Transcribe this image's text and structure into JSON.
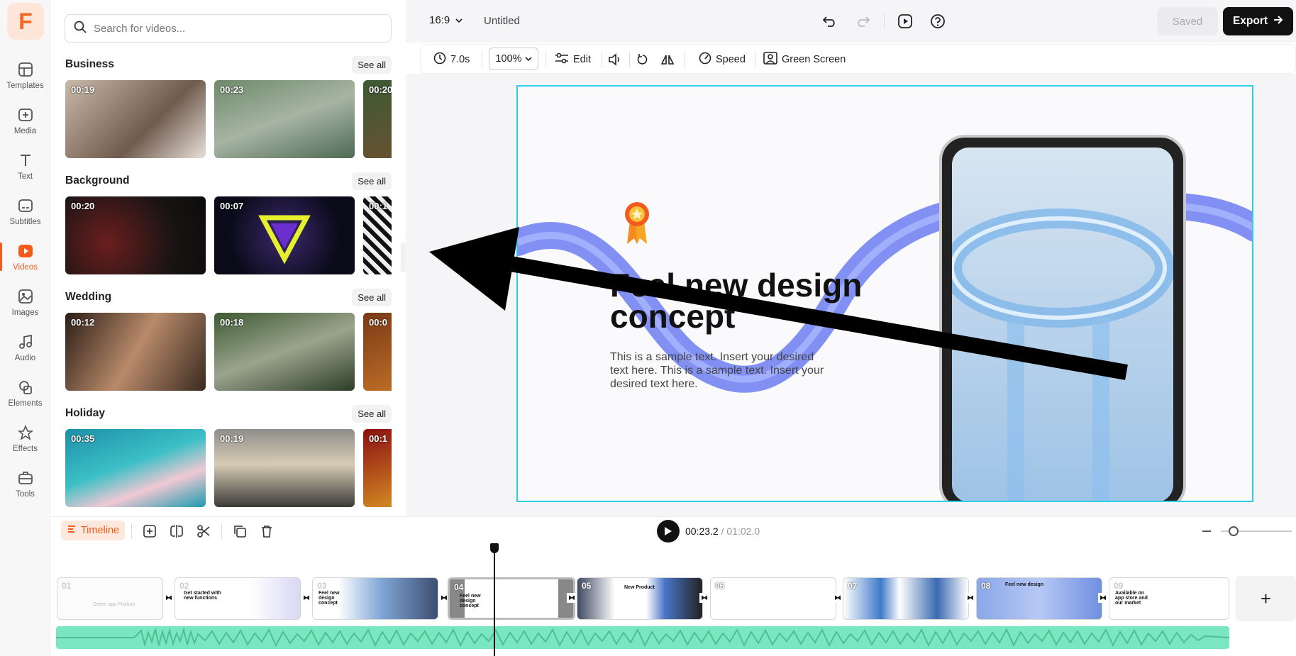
{
  "app": {
    "logo_letter": "F",
    "accent": "#f25b1c",
    "selection_color": "#2ad1e6"
  },
  "rail": [
    {
      "label": "Templates",
      "icon": "templates-icon"
    },
    {
      "label": "Media",
      "icon": "media-icon"
    },
    {
      "label": "Text",
      "icon": "text-icon"
    },
    {
      "label": "Subtitles",
      "icon": "subtitles-icon"
    },
    {
      "label": "Videos",
      "icon": "videos-icon",
      "active": true
    },
    {
      "label": "Images",
      "icon": "images-icon"
    },
    {
      "label": "Audio",
      "icon": "audio-icon"
    },
    {
      "label": "Elements",
      "icon": "elements-icon"
    },
    {
      "label": "Effects",
      "icon": "effects-icon"
    },
    {
      "label": "Tools",
      "icon": "tools-icon"
    }
  ],
  "panel": {
    "search_placeholder": "Search for videos...",
    "see_all": "See all",
    "categories": [
      {
        "title": "Business",
        "thumbs": [
          "00:19",
          "00:23",
          "00:20"
        ]
      },
      {
        "title": "Background",
        "thumbs": [
          "00:20",
          "00:07",
          "00:1"
        ]
      },
      {
        "title": "Wedding",
        "thumbs": [
          "00:12",
          "00:18",
          "00:0"
        ]
      },
      {
        "title": "Holiday",
        "thumbs": [
          "00:35",
          "00:19",
          "00:1"
        ]
      }
    ]
  },
  "topbar": {
    "ratio": "16:9",
    "title": "Untitled",
    "saved": "Saved",
    "export": "Export"
  },
  "toolbar": {
    "duration": "7.0s",
    "zoom": "100%",
    "edit": "Edit",
    "speed": "Speed",
    "green_screen": "Green Screen"
  },
  "canvas": {
    "headline": "Feel new design concept",
    "body": "This is a sample text. Insert your desired text here. This is a sample text. Insert your desired text here."
  },
  "timeline": {
    "label": "Timeline",
    "current": "00:23.2",
    "total": "/ 01:02.0",
    "clips": [
      "01",
      "02",
      "03",
      "04",
      "05",
      "06",
      "07",
      "08",
      "09"
    ],
    "clip_captions": {
      "01": "Green app Product",
      "02": "Get started with new functions",
      "03": "Feel new design concept",
      "04": "Feel new design concept",
      "05": "New Product",
      "08": "Feel new design",
      "09": "Available on app store and our market"
    },
    "add": "+"
  }
}
